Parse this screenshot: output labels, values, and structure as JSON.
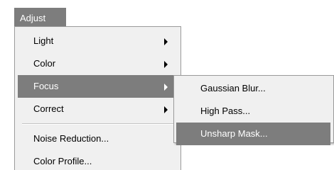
{
  "menubar": {
    "adjust_label": "Adjust"
  },
  "main_menu": {
    "items": [
      {
        "label": "Light",
        "has_submenu": true
      },
      {
        "label": "Color",
        "has_submenu": true
      },
      {
        "label": "Focus",
        "has_submenu": true,
        "active": true
      },
      {
        "label": "Correct",
        "has_submenu": true
      },
      {
        "label": "Noise Reduction...",
        "has_submenu": false
      },
      {
        "label": "Color Profile...",
        "has_submenu": false
      }
    ]
  },
  "focus_submenu": {
    "items": [
      {
        "label": "Gaussian Blur..."
      },
      {
        "label": "High Pass..."
      },
      {
        "label": "Unsharp Mask...",
        "active": true
      }
    ]
  },
  "colors": {
    "highlight": "#7d7d7d",
    "menu_background": "#f0f0f0",
    "menu_border": "#9a9a9a"
  }
}
